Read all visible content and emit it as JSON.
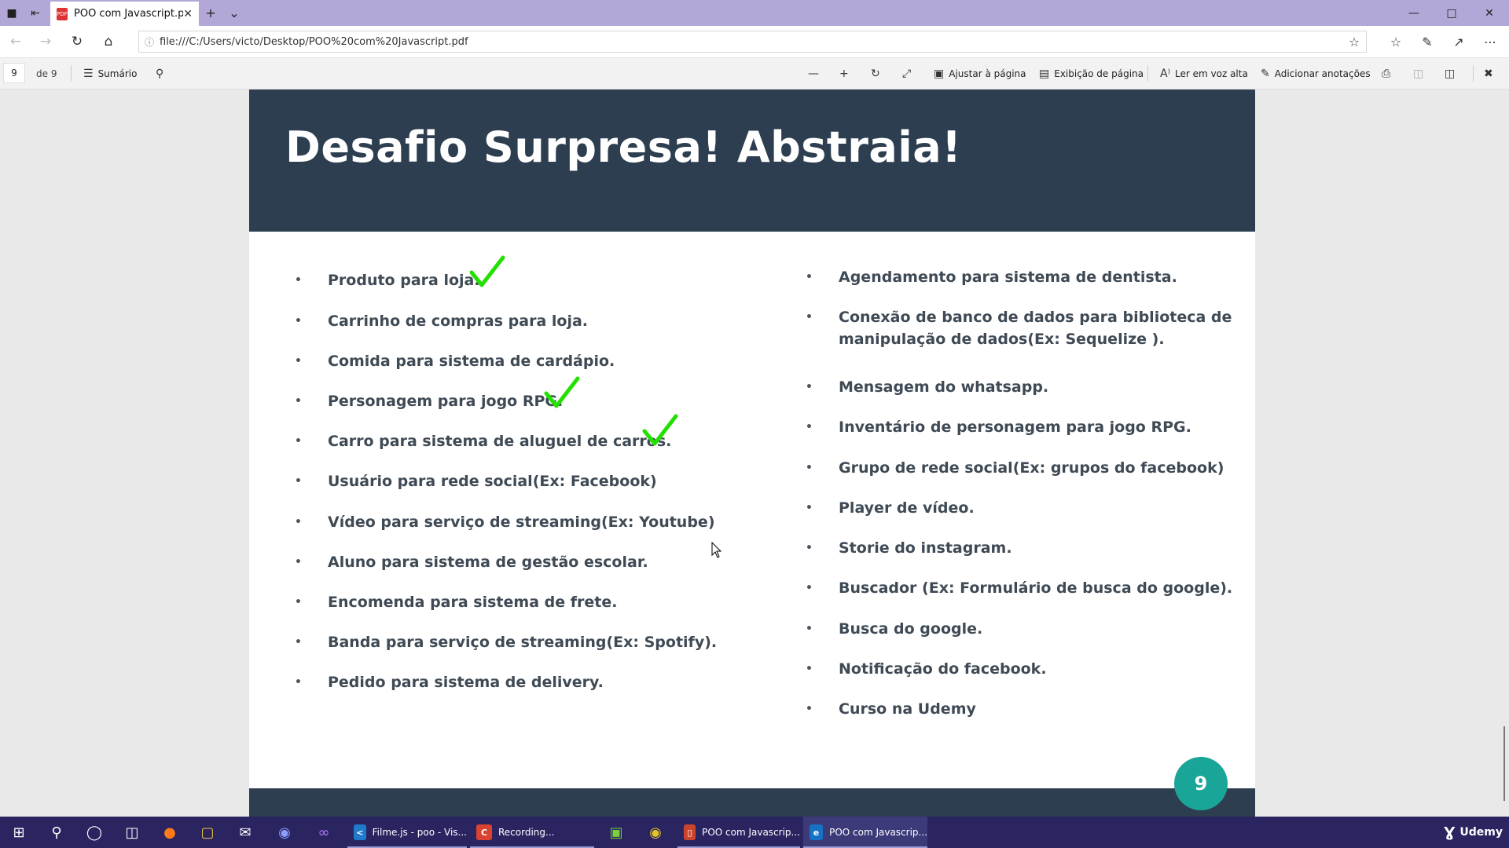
{
  "browser": {
    "tab_title": "POO com Javascript.pdf",
    "url": "file:///C:/Users/victo/Desktop/POO%20com%20Javascript.pdf"
  },
  "pdf_toolbar": {
    "current_page": "9",
    "page_of": "de 9",
    "summary": "Sumário",
    "fit_page": "Ajustar à página",
    "page_view": "Exibição de página",
    "read_aloud": "Ler em voz alta",
    "add_notes": "Adicionar anotações"
  },
  "slide": {
    "title": "Desafio Surpresa! Abstraia!",
    "page_number": "9",
    "left_items": [
      {
        "text": "Produto para loja.",
        "checked": true
      },
      {
        "text": "Carrinho de compras para loja.",
        "checked": false
      },
      {
        "text": "Comida para sistema de cardápio.",
        "checked": false
      },
      {
        "text": "Personagem para jogo RPG.",
        "checked": true
      },
      {
        "text": "Carro para sistema de aluguel de carros.",
        "checked": true
      },
      {
        "text": "Usuário para rede social(Ex: Facebook)",
        "checked": false
      },
      {
        "text": "Vídeo para serviço de streaming(Ex: Youtube)",
        "checked": false
      },
      {
        "text": "Aluno para sistema de gestão escolar.",
        "checked": false
      },
      {
        "text": "Encomenda para sistema de frete.",
        "checked": false
      },
      {
        "text": "Banda para serviço de streaming(Ex: Spotify).",
        "checked": false
      },
      {
        "text": "Pedido para sistema de delivery.",
        "checked": false
      }
    ],
    "right_items": [
      {
        "line1": "Agendamento para sistema de dentista.",
        "line2": ""
      },
      {
        "line1": "Conexão de banco de dados para biblioteca de",
        "line2": "manipulação de dados(Ex: Sequelize )."
      },
      {
        "line1": "Mensagem do whatsapp.",
        "line2": ""
      },
      {
        "line1": "Inventário de personagem para jogo RPG.",
        "line2": ""
      },
      {
        "line1": "Grupo de rede social(Ex: grupos do facebook)",
        "line2": ""
      },
      {
        "line1": "Player de vídeo.",
        "line2": ""
      },
      {
        "line1": "Storie do instagram.",
        "line2": ""
      },
      {
        "line1": "Buscador (Ex: Formulário de busca do google).",
        "line2": ""
      },
      {
        "line1": "Busca do google.",
        "line2": ""
      },
      {
        "line1": "Notificação do facebook.",
        "line2": ""
      },
      {
        "line1": "Curso na Udemy",
        "line2": ""
      }
    ],
    "check_color": "#22e000"
  },
  "taskbar": {
    "apps": [
      {
        "label": "Filme.js - poo - Vis...",
        "color": "#1f7acc",
        "icon": "vscode-icon"
      },
      {
        "label": "Recording...",
        "color": "#d9432f",
        "icon": "recording-icon"
      },
      {
        "label": "POO com Javascrip...",
        "color": "#c9442b",
        "icon": "pdf-icon"
      },
      {
        "label": "POO com Javascrip...",
        "color": "#1572c4",
        "icon": "edge-icon"
      }
    ],
    "brand": "Udemy"
  }
}
